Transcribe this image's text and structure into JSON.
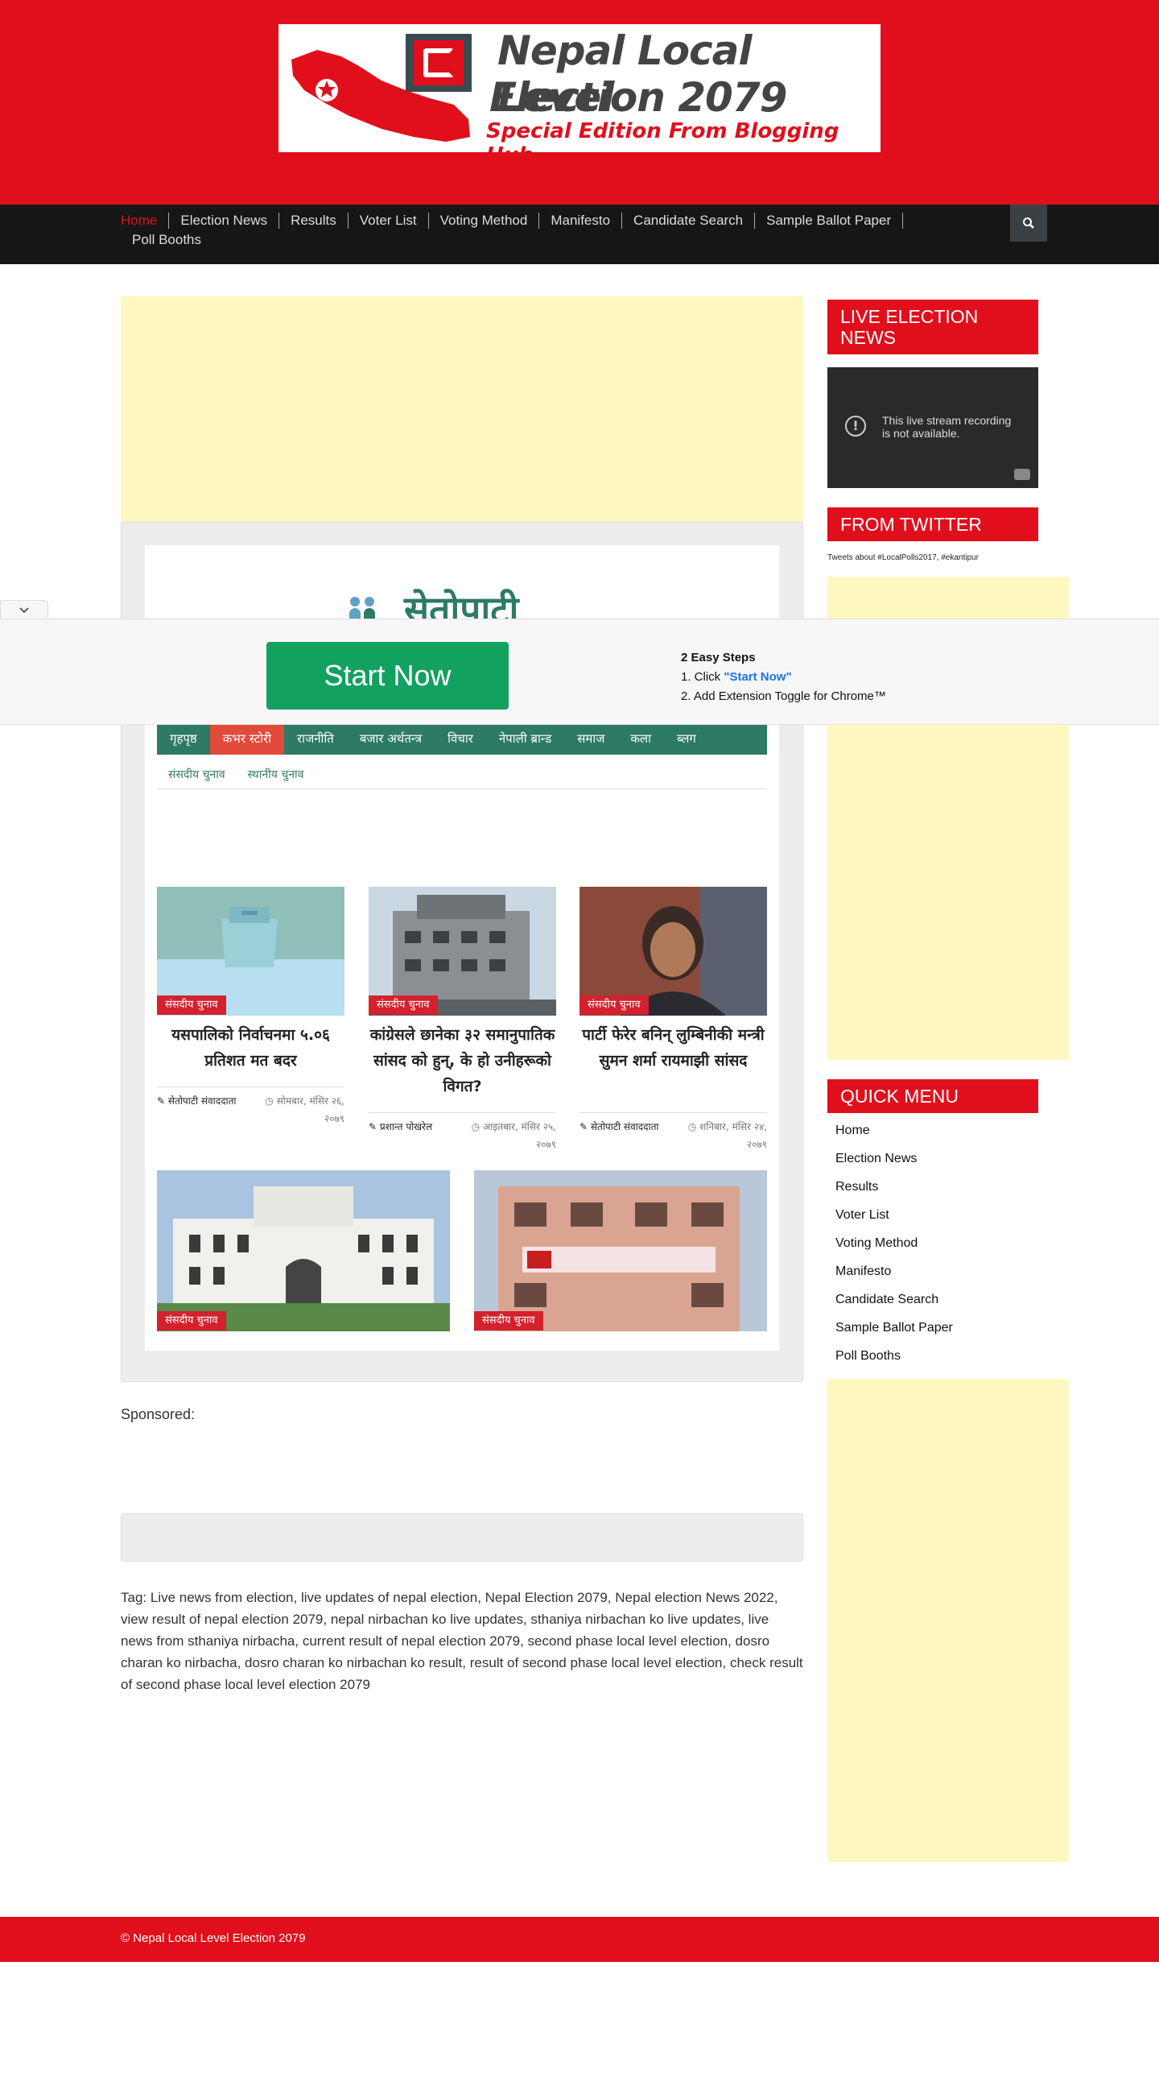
{
  "banner": {
    "title_line1": "Nepal Local Level",
    "title_line2": "Election 2079",
    "subtitle": "Special Edition From Blogging Hub"
  },
  "nav": {
    "items": [
      "Home",
      "Election News",
      "Results",
      "Voter List",
      "Voting Method",
      "Manifesto",
      "Candidate Search",
      "Sample Ballot Paper",
      "Poll Booths"
    ],
    "search_icon": "search-icon"
  },
  "embed": {
    "logo_text": "सेतोपाटी",
    "nav_items": [
      "गृहपृष्ठ",
      "कभर स्टोरी",
      "राजनीति",
      "बजार अर्थतन्त्र",
      "विचार",
      "नेपाली ब्रान्ड",
      "समाज",
      "कला",
      "ब्लग"
    ],
    "active_nav": "कभर स्टोरी",
    "sub_items": [
      "संसदीय चुनाव",
      "स्थानीय चुनाव"
    ],
    "articles": [
      {
        "tag": "संसदीय चुनाव",
        "title": "यसपालिको निर्वाचनमा ५.०६ प्रतिशत मत बदर",
        "author": "सेतोपाटी संवाददाता",
        "date": "सोमबार, मंसिर २६, २०७९"
      },
      {
        "tag": "संसदीय चुनाव",
        "title": "कांग्रेसले छानेका ३२ समानुपातिक सांसद को हुन्, के हो उनीहरूको विगत?",
        "author": "प्रशान्त पोखरेल",
        "date": "आइतबार, मंसिर २५, २०७९"
      },
      {
        "tag": "संसदीय चुनाव",
        "title": "पार्टी फेरेर बनिन् लुम्बिनीकी मन्त्री सुमन शर्मा रायमाझी सांसद",
        "author": "सेतोपाटी संवाददाता",
        "date": "शनिबार, मंसिर २४, २०७९"
      },
      {
        "tag": "संसदीय चुनाव"
      },
      {
        "tag": "संसदीय चुनाव"
      }
    ]
  },
  "sidebar": {
    "live_heading": "LIVE ELECTION NEWS",
    "video_message_line1": "This live stream recording",
    "video_message_line2": "is not available.",
    "twitter_heading": "FROM TWITTER",
    "tweets_text": "Tweets about #LocalPolls2017, #ekantipur",
    "quick_heading": "QUICK MENU",
    "quick_items": [
      "Home",
      "Election News",
      "Results",
      "Voter List",
      "Voting Method",
      "Manifesto",
      "Candidate Search",
      "Sample Ballot Paper",
      "Poll Booths"
    ]
  },
  "main": {
    "sponsored_label": "Sponsored:",
    "tags_text": "Tag: Live news from election, live updates of nepal election, Nepal Election 2079, Nepal election News 2022, view result of nepal election 2079, nepal nirbachan ko live updates, sthaniya nirbachan ko live updates, live news from sthaniya nirbacha, current result of nepal election 2079, second phase local level election, dosro charan ko nirbacha, dosro charan ko nirbachan ko result, result of second phase local level election, check result of second phase local level election 2079"
  },
  "overlay": {
    "button_label": "Start Now",
    "steps_heading": "2 Easy Steps",
    "step1_prefix": "1. Click ",
    "step1_link": "\"Start Now\"",
    "step2": "2. Add Extension Toggle for Chrome™"
  },
  "footer": {
    "copyright": "© Nepal Local Level Election 2079"
  },
  "colors": {
    "brand_red": "#e10f1c",
    "nav_dark": "#161616",
    "setopati_green": "#2d7a66",
    "ad_yellow": "#fef8c0",
    "start_green": "#13a160"
  }
}
